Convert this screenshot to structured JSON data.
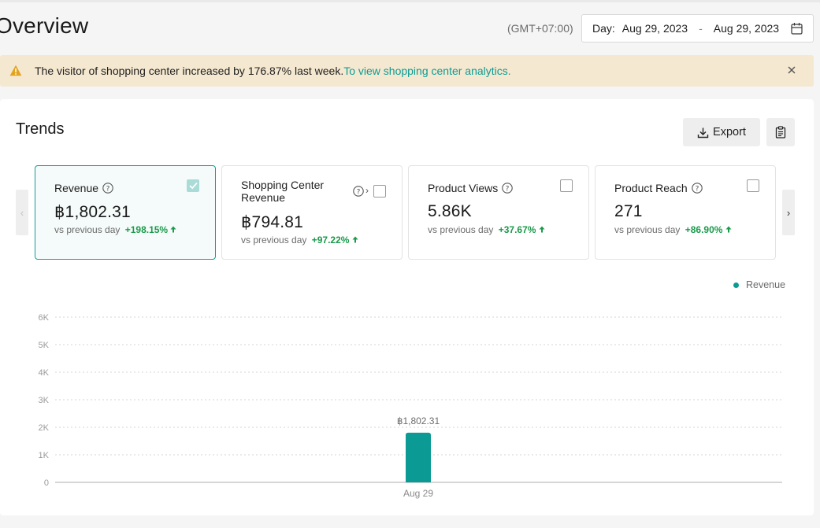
{
  "header": {
    "title": "Overview",
    "timezone": "(GMT+07:00)",
    "date_label": "Day:",
    "date_start": "Aug 29, 2023",
    "date_sep": "-",
    "date_end": "Aug 29, 2023"
  },
  "alert": {
    "message": "The visitor of shopping center increased by 176.87% last week.",
    "link_text": "To view shopping center analytics."
  },
  "trends": {
    "title": "Trends",
    "export_label": "Export",
    "cards": [
      {
        "title": "Revenue",
        "value": "฿1,802.31",
        "compare_label": "vs previous day",
        "change": "+198.15%",
        "checked": true
      },
      {
        "title": "Shopping Center Revenue",
        "value": "฿794.81",
        "compare_label": "vs previous day",
        "change": "+97.22%",
        "checked": false
      },
      {
        "title": "Product Views",
        "value": "5.86K",
        "compare_label": "vs previous day",
        "change": "+37.67%",
        "checked": false
      },
      {
        "title": "Product Reach",
        "value": "271",
        "compare_label": "vs previous day",
        "change": "+86.90%",
        "checked": false
      }
    ],
    "legend_label": "Revenue"
  },
  "colors": {
    "accent": "#0b9b94",
    "positive": "#1a9a4b",
    "alert_bg": "#f5e8d0"
  },
  "chart_data": {
    "type": "bar",
    "categories": [
      "Aug 29"
    ],
    "series": [
      {
        "name": "Revenue",
        "values": [
          1802.31
        ]
      }
    ],
    "data_labels": [
      "฿1,802.31"
    ],
    "y_ticks": [
      "0",
      "1K",
      "2K",
      "3K",
      "4K",
      "5K",
      "6K"
    ],
    "ylim": [
      0,
      6000
    ],
    "grid": true,
    "legend_position": "top-right"
  }
}
